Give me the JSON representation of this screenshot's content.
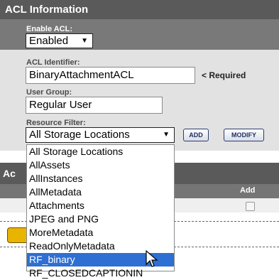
{
  "panel": {
    "title": "ACL Information"
  },
  "enable_acl": {
    "label": "Enable ACL:",
    "value": "Enabled",
    "arrow": "▼"
  },
  "acl_identifier": {
    "label": "ACL Identifier:",
    "value": "BinaryAttachmentACL",
    "required_note": "< Required"
  },
  "user_group": {
    "label": "User Group:",
    "value": "Regular User"
  },
  "resource_filter": {
    "label": "Resource Filter:",
    "value": "All Storage Locations",
    "arrow": "▼",
    "add_label": "ADD",
    "modify_label": "MODIFY",
    "options": [
      "All Storage Locations",
      "AllAssets",
      "AllInstances",
      "AllMetadata",
      "Attachments",
      "JPEG and PNG",
      "MoreMetadata",
      "ReadOnlyMetadata",
      "RF_binary",
      "RF_CLOSEDCAPTIONIN"
    ],
    "highlighted_option": "RF_binary"
  },
  "section2": {
    "title_fragment": "Ac",
    "add_column": "Add"
  }
}
